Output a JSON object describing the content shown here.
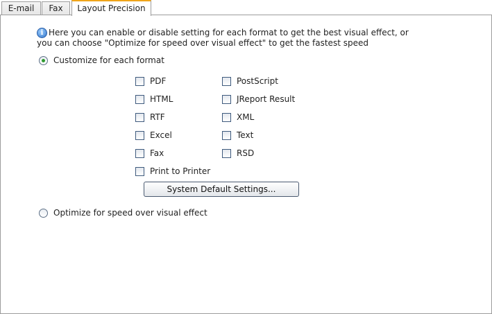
{
  "tabs": [
    {
      "label": "E-mail",
      "active": false
    },
    {
      "label": "Fax",
      "active": false
    },
    {
      "label": "Layout Precision",
      "active": true
    }
  ],
  "info": {
    "icon": "info-icon",
    "text": "Here you can enable or disable setting for each format to get the best visual effect, or you can choose \"Optimize for speed over visual effect\" to get the fastest speed"
  },
  "options": {
    "customize": {
      "label": "Customize for each format",
      "checked": true
    },
    "optimize": {
      "label": "Optimize for speed over visual effect",
      "checked": false
    }
  },
  "formats_left": [
    {
      "label": "PDF",
      "checked": false
    },
    {
      "label": "HTML",
      "checked": false
    },
    {
      "label": "RTF",
      "checked": false
    },
    {
      "label": "Excel",
      "checked": false
    },
    {
      "label": "Fax",
      "checked": false
    },
    {
      "label": "Print to Printer",
      "checked": false
    }
  ],
  "formats_right": [
    {
      "label": "PostScript",
      "checked": false
    },
    {
      "label": "JReport Result",
      "checked": false
    },
    {
      "label": "XML",
      "checked": false
    },
    {
      "label": "Text",
      "checked": false
    },
    {
      "label": "RSD",
      "checked": false
    }
  ],
  "system_default_button": "System Default Settings...",
  "colors": {
    "active_tab_accent": "#f0a51a",
    "radio_dot": "#2e9a2e",
    "border": "#9c9c9c"
  }
}
